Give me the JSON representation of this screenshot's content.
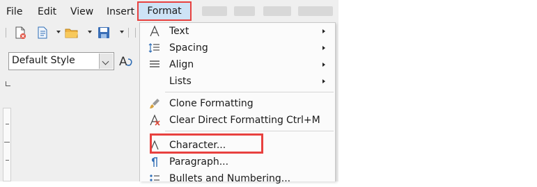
{
  "menubar": {
    "items": [
      {
        "label": "File"
      },
      {
        "label": "Edit"
      },
      {
        "label": "View"
      },
      {
        "label": "Insert"
      },
      {
        "label": "Format"
      }
    ]
  },
  "toolbar": {
    "style_combo_value": "Default Style"
  },
  "format_menu": {
    "items": [
      {
        "label": "Text",
        "icon": "text-a-icon",
        "submenu": true
      },
      {
        "label": "Spacing",
        "icon": "spacing-icon",
        "submenu": true
      },
      {
        "label": "Align",
        "icon": "align-icon",
        "submenu": true
      },
      {
        "label": "Lists",
        "icon": "",
        "submenu": true
      },
      {
        "label": "Clone Formatting",
        "icon": "paintbrush-icon",
        "submenu": false
      },
      {
        "label": "Clear Direct Formatting",
        "shortcut": "Ctrl+M",
        "icon": "clear-formatting-icon",
        "submenu": false
      },
      {
        "label": "Character...",
        "icon": "character-icon",
        "submenu": false
      },
      {
        "label": "Paragraph...",
        "icon": "paragraph-icon",
        "submenu": false
      },
      {
        "label": "Bullets and Numbering...",
        "icon": "bullets-icon",
        "submenu": false
      }
    ]
  },
  "colors": {
    "highlight_border": "#e8413f",
    "active_menu_bg": "#cde3f6"
  }
}
